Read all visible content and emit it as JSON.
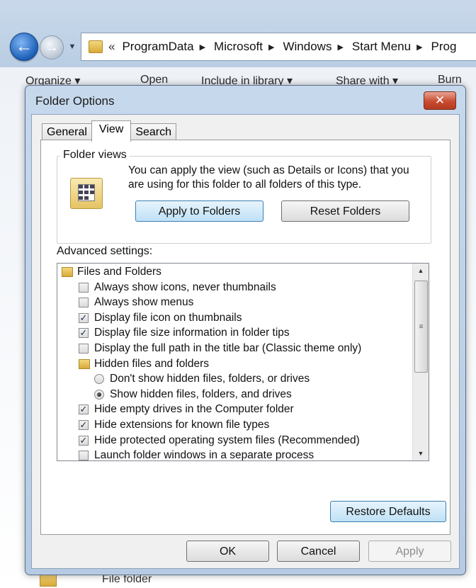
{
  "explorer": {
    "address": {
      "chevrons": "«",
      "crumbs": [
        "ProgramData",
        "Microsoft",
        "Windows",
        "Start Menu",
        "Prog"
      ]
    },
    "toolbar": {
      "organize": "Organize ▾",
      "open": "Open",
      "include": "Include in library ▾",
      "share": "Share with ▾",
      "burn": "Burn"
    },
    "bottom_item_type": "File folder"
  },
  "dialog": {
    "title": "Folder Options",
    "close_glyph": "✕",
    "tabs": [
      {
        "label": "General",
        "active": false
      },
      {
        "label": "View",
        "active": true
      },
      {
        "label": "Search",
        "active": false
      }
    ],
    "folder_views": {
      "title": "Folder views",
      "description": "You can apply the view (such as Details or Icons) that you are using for this folder to all folders of this type.",
      "apply_label": "Apply to Folders",
      "reset_label": "Reset Folders"
    },
    "advanced_label": "Advanced settings:",
    "settings": [
      {
        "type": "folder",
        "label": "Files and Folders",
        "indent": 0
      },
      {
        "type": "checkbox",
        "label": "Always show icons, never thumbnails",
        "checked": false,
        "indent": 1
      },
      {
        "type": "checkbox",
        "label": "Always show menus",
        "checked": false,
        "indent": 1
      },
      {
        "type": "checkbox",
        "label": "Display file icon on thumbnails",
        "checked": true,
        "indent": 1
      },
      {
        "type": "checkbox",
        "label": "Display file size information in folder tips",
        "checked": true,
        "indent": 1
      },
      {
        "type": "checkbox",
        "label": "Display the full path in the title bar (Classic theme only)",
        "checked": false,
        "indent": 1
      },
      {
        "type": "folder",
        "label": "Hidden files and folders",
        "indent": 1
      },
      {
        "type": "radio",
        "label": "Don't show hidden files, folders, or drives",
        "checked": false,
        "indent": 2
      },
      {
        "type": "radio",
        "label": "Show hidden files, folders, and drives",
        "checked": true,
        "indent": 2
      },
      {
        "type": "checkbox",
        "label": "Hide empty drives in the Computer folder",
        "checked": true,
        "indent": 1
      },
      {
        "type": "checkbox",
        "label": "Hide extensions for known file types",
        "checked": true,
        "indent": 1
      },
      {
        "type": "checkbox",
        "label": "Hide protected operating system files (Recommended)",
        "checked": true,
        "indent": 1
      },
      {
        "type": "checkbox",
        "label": "Launch folder windows in a separate process",
        "checked": false,
        "indent": 1
      }
    ],
    "check_glyph": "✓",
    "restore_label": "Restore Defaults",
    "ok_label": "OK",
    "cancel_label": "Cancel",
    "apply_label": "Apply"
  }
}
